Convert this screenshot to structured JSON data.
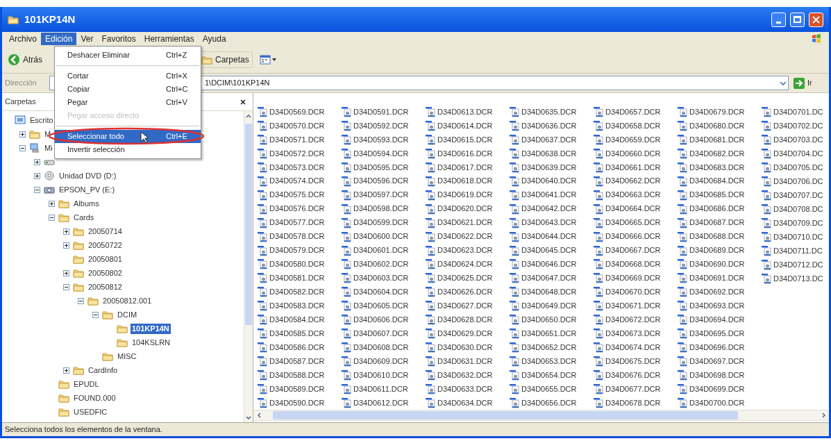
{
  "window": {
    "title": "101KP14N"
  },
  "menu_bar": [
    {
      "label": "Archivo",
      "selected": false
    },
    {
      "label": "Edición",
      "selected": true
    },
    {
      "label": "Ver",
      "selected": false
    },
    {
      "label": "Favoritos",
      "selected": false
    },
    {
      "label": "Herramientas",
      "selected": false
    },
    {
      "label": "Ayuda",
      "selected": false
    }
  ],
  "toolbar": {
    "back_label": "Atrás",
    "folders_label": "Carpetas"
  },
  "address_bar": {
    "label": "Dirección",
    "value": "1\\DCIM\\101KP14N",
    "go_label": "Ir"
  },
  "edit_menu": [
    {
      "kind": "item",
      "label": "Deshacer Eliminar",
      "shortcut": "Ctrl+Z",
      "disabled": false,
      "selected": false
    },
    {
      "kind": "separator"
    },
    {
      "kind": "item",
      "label": "Cortar",
      "shortcut": "Ctrl+X",
      "disabled": false,
      "selected": false
    },
    {
      "kind": "item",
      "label": "Copiar",
      "shortcut": "Ctrl+C",
      "disabled": false,
      "selected": false
    },
    {
      "kind": "item",
      "label": "Pegar",
      "shortcut": "Ctrl+V",
      "disabled": false,
      "selected": false
    },
    {
      "kind": "item",
      "label": "Pegar acceso directo",
      "disabled": true,
      "selected": false
    },
    {
      "kind": "separator"
    },
    {
      "kind": "item",
      "label": "Seleccionar todo",
      "shortcut": "Ctrl+E",
      "disabled": false,
      "selected": true
    },
    {
      "kind": "item",
      "label": "Invertir selección",
      "disabled": false,
      "selected": false
    }
  ],
  "folders_pane": {
    "title": "Carpetas",
    "tree": [
      {
        "label": "Escrito",
        "kind": "desktop",
        "selected": false,
        "children": [
          {
            "label": "M",
            "kind": "documents",
            "expanded": false,
            "selected": false
          },
          {
            "label": "Mi",
            "kind": "computer",
            "expanded": true,
            "selected": false,
            "children": [
              {
                "kind": "drive",
                "expanded": false,
                "selected": false
              },
              {
                "label": "Unidad DVD (D:)",
                "kind": "dvd",
                "expanded": false,
                "selected": false
              },
              {
                "label": "EPSON_PV (E:)",
                "kind": "camera",
                "expanded": true,
                "selected": false,
                "children": [
                  {
                    "label": "Albums",
                    "kind": "folder",
                    "expanded": false,
                    "selected": false
                  },
                  {
                    "label": "Cards",
                    "kind": "folder",
                    "expanded": true,
                    "selected": false,
                    "children": [
                      {
                        "label": "20050714",
                        "kind": "folder",
                        "expanded": false,
                        "selected": false
                      },
                      {
                        "label": "20050722",
                        "kind": "folder",
                        "expanded": false,
                        "selected": false
                      },
                      {
                        "label": "20050801",
                        "kind": "folder",
                        "selected": false
                      },
                      {
                        "label": "20050802",
                        "kind": "folder",
                        "expanded": false,
                        "selected": false
                      },
                      {
                        "label": "20050812",
                        "kind": "folder",
                        "expanded": true,
                        "selected": false,
                        "children": [
                          {
                            "label": "20050812.001",
                            "kind": "folder",
                            "expanded": true,
                            "selected": false,
                            "children": [
                              {
                                "label": "DCIM",
                                "kind": "folder",
                                "expanded": true,
                                "selected": false,
                                "children": [
                                  {
                                    "label": "101KP14N",
                                    "kind": "folder",
                                    "selected": true
                                  },
                                  {
                                    "label": "104KSLRN",
                                    "kind": "folder",
                                    "selected": false
                                  }
                                ]
                              },
                              {
                                "label": "MISC",
                                "kind": "folder",
                                "selected": false
                              }
                            ]
                          }
                        ]
                      },
                      {
                        "label": "CardInfo",
                        "kind": "folder",
                        "expanded": false,
                        "selected": false
                      }
                    ]
                  },
                  {
                    "label": "EPUDL",
                    "kind": "folder",
                    "selected": false
                  },
                  {
                    "label": "FOUND.000",
                    "kind": "folder",
                    "selected": false
                  },
                  {
                    "label": "USEDFIC",
                    "kind": "folder",
                    "selected": false
                  }
                ]
              }
            ]
          }
        ]
      }
    ]
  },
  "file_columns": [
    [
      "D34D0569.DCR",
      "D34D0570.DCR",
      "D34D0571.DCR",
      "D34D0572.DCR",
      "D34D0573.DCR",
      "D34D0574.DCR",
      "D34D0575.DCR",
      "D34D0576.DCR",
      "D34D0577.DCR",
      "D34D0578.DCR",
      "D34D0579.DCR",
      "D34D0580.DCR",
      "D34D0581.DCR",
      "D34D0582.DCR",
      "D34D0583.DCR",
      "D34D0584.DCR",
      "D34D0585.DCR",
      "D34D0586.DCR",
      "D34D0587.DCR",
      "D34D0588.DCR",
      "D34D0589.DCR",
      "D34D0590.DCR"
    ],
    [
      "D34D0591.DCR",
      "D34D0592.DCR",
      "D34D0593.DCR",
      "D34D0594.DCR",
      "D34D0595.DCR",
      "D34D0596.DCR",
      "D34D0597.DCR",
      "D34D0598.DCR",
      "D34D0599.DCR",
      "D34D0600.DCR",
      "D34D0601.DCR",
      "D34D0602.DCR",
      "D34D0603.DCR",
      "D34D0604.DCR",
      "D34D0605.DCR",
      "D34D0606.DCR",
      "D34D0607.DCR",
      "D34D0608.DCR",
      "D34D0609.DCR",
      "D34D0610.DCR",
      "D34D0611.DCR",
      "D34D0612.DCR"
    ],
    [
      "D34D0613.DCR",
      "D34D0614.DCR",
      "D34D0615.DCR",
      "D34D0616.DCR",
      "D34D0617.DCR",
      "D34D0618.DCR",
      "D34D0619.DCR",
      "D34D0620.DCR",
      "D34D0621.DCR",
      "D34D0622.DCR",
      "D34D0623.DCR",
      "D34D0624.DCR",
      "D34D0625.DCR",
      "D34D0626.DCR",
      "D34D0627.DCR",
      "D34D0628.DCR",
      "D34D0629.DCR",
      "D34D0630.DCR",
      "D34D0631.DCR",
      "D34D0632.DCR",
      "D34D0633.DCR",
      "D34D0634.DCR"
    ],
    [
      "D34D0635.DCR",
      "D34D0636.DCR",
      "D34D0637.DCR",
      "D34D0638.DCR",
      "D34D0639.DCR",
      "D34D0640.DCR",
      "D34D0641.DCR",
      "D34D0642.DCR",
      "D34D0643.DCR",
      "D34D0644.DCR",
      "D34D0645.DCR",
      "D34D0646.DCR",
      "D34D0647.DCR",
      "D34D0648.DCR",
      "D34D0649.DCR",
      "D34D0650.DCR",
      "D34D0651.DCR",
      "D34D0652.DCR",
      "D34D0653.DCR",
      "D34D0654.DCR",
      "D34D0655.DCR",
      "D34D0656.DCR"
    ],
    [
      "D34D0657.DCR",
      "D34D0658.DCR",
      "D34D0659.DCR",
      "D34D0660.DCR",
      "D34D0661.DCR",
      "D34D0662.DCR",
      "D34D0663.DCR",
      "D34D0664.DCR",
      "D34D0665.DCR",
      "D34D0666.DCR",
      "D34D0667.DCR",
      "D34D0668.DCR",
      "D34D0669.DCR",
      "D34D0670.DCR",
      "D34D0671.DCR",
      "D34D0672.DCR",
      "D34D0673.DCR",
      "D34D0674.DCR",
      "D34D0675.DCR",
      "D34D0676.DCR",
      "D34D0677.DCR",
      "D34D0678.DCR"
    ],
    [
      "D34D0679.DCR",
      "D34D0680.DCR",
      "D34D0681.DCR",
      "D34D0682.DCR",
      "D34D0683.DCR",
      "D34D0684.DCR",
      "D34D0685.DCR",
      "D34D0686.DCR",
      "D34D0687.DCR",
      "D34D0688.DCR",
      "D34D0689.DCR",
      "D34D0690.DCR",
      "D34D0691.DCR",
      "D34D0692.DCR",
      "D34D0693.DCR",
      "D34D0694.DCR",
      "D34D0695.DCR",
      "D34D0696.DCR",
      "D34D0697.DCR",
      "D34D0698.DCR",
      "D34D0699.DCR",
      "D34D0700.DCR"
    ],
    [
      "D34D0701.DC",
      "D34D0702.DC",
      "D34D0703.DC",
      "D34D0704.DC",
      "D34D0705.DC",
      "D34D0706.DC",
      "D34D0707.DC",
      "D34D0708.DC",
      "D34D0709.DC",
      "D34D0710.DC",
      "D34D0711.DC",
      "D34D0712.DC",
      "D34D0713.DC"
    ]
  ],
  "status_bar": "Selecciona todos los elementos de la ventana."
}
